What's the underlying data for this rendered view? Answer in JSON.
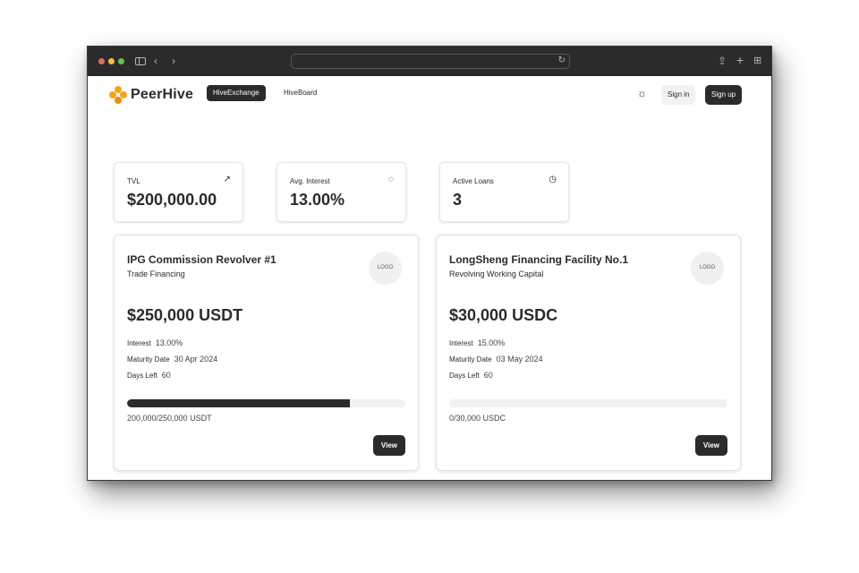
{
  "browser": {
    "icons": [
      "sidebar-icon",
      "back-icon",
      "forward-icon",
      "reload-icon",
      "share-icon",
      "plus-icon",
      "tabs-icon"
    ]
  },
  "nav": {
    "brand": "PeerHive",
    "active_tab": "HiveExchange",
    "link": "HiveBoard",
    "sign_in": "Sign in",
    "sign_up": "Sign up"
  },
  "stats": [
    {
      "label": "TVL",
      "value": "$200,000.00",
      "icon": "arrow-up-right-icon"
    },
    {
      "label": "Avg. Interest",
      "value": "13.00%",
      "icon": "piggy-bank-icon"
    },
    {
      "label": "Active Loans",
      "value": "3",
      "icon": "clock-icon"
    }
  ],
  "loans": [
    {
      "title": "IPG Commission Revolver #1",
      "subtitle": "Trade Financing",
      "logo": "LOGO",
      "amount": "$250,000 USDT",
      "interest_label": "Interest",
      "interest": "13.00%",
      "maturity_label": "Maturity Date",
      "maturity": "30 Apr 2024",
      "days_label": "Days Left",
      "days": "60",
      "progress_fraction": 0.8,
      "progress_text": "200,000/250,000 USDT",
      "view": "View"
    },
    {
      "title": "LongSheng Financing Facility No.1",
      "subtitle": "Revolving Working Capital",
      "logo": "LOGO",
      "amount": "$30,000 USDC",
      "interest_label": "Interest",
      "interest": "15.00%",
      "maturity_label": "Maturity Date",
      "maturity": "03 May 2024",
      "days_label": "Days Left",
      "days": "60",
      "progress_fraction": 0.0,
      "progress_text": "0/30,000 USDC",
      "view": "View"
    }
  ],
  "colors": {
    "brand": "#f3a51b",
    "dark": "#2c2a2b",
    "titlebar": "#2b2b2b"
  }
}
